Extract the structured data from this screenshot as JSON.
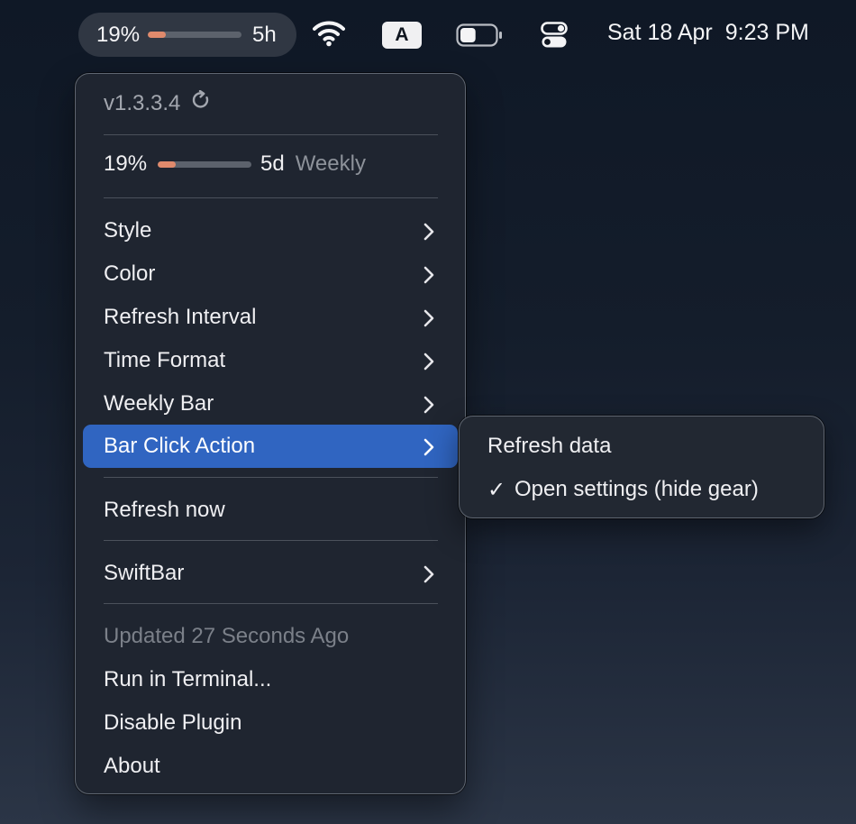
{
  "menubar": {
    "status": {
      "percent": "19%",
      "usage_fraction": 0.19,
      "time": "5h"
    },
    "input_label": "A",
    "battery_fraction": 0.45,
    "date": "Sat 18 Apr",
    "time": "9:23 PM"
  },
  "menu": {
    "version": "v1.3.3.4",
    "weekly": {
      "percent": "19%",
      "usage_fraction": 0.19,
      "time": "5d",
      "label": "Weekly"
    },
    "items": [
      {
        "label": "Style",
        "submenu": true
      },
      {
        "label": "Color",
        "submenu": true
      },
      {
        "label": "Refresh Interval",
        "submenu": true
      },
      {
        "label": "Time Format",
        "submenu": true
      },
      {
        "label": "Weekly Bar",
        "submenu": true
      },
      {
        "label": "Bar Click Action",
        "submenu": true,
        "highlighted": true
      }
    ],
    "refresh_now": "Refresh now",
    "swiftbar": "SwiftBar",
    "updated": "Updated 27 Seconds Ago",
    "run_in_terminal": "Run in Terminal...",
    "disable_plugin": "Disable Plugin",
    "about": "About"
  },
  "submenu": {
    "items": [
      {
        "label": "Refresh data",
        "checked": false
      },
      {
        "label": "Open settings (hide gear)",
        "checked": true
      }
    ],
    "check_mark": "✓"
  },
  "colors": {
    "highlight": "#3065c1",
    "usage_fill": "#e08a6c",
    "menu_bg": "#1f2530"
  }
}
